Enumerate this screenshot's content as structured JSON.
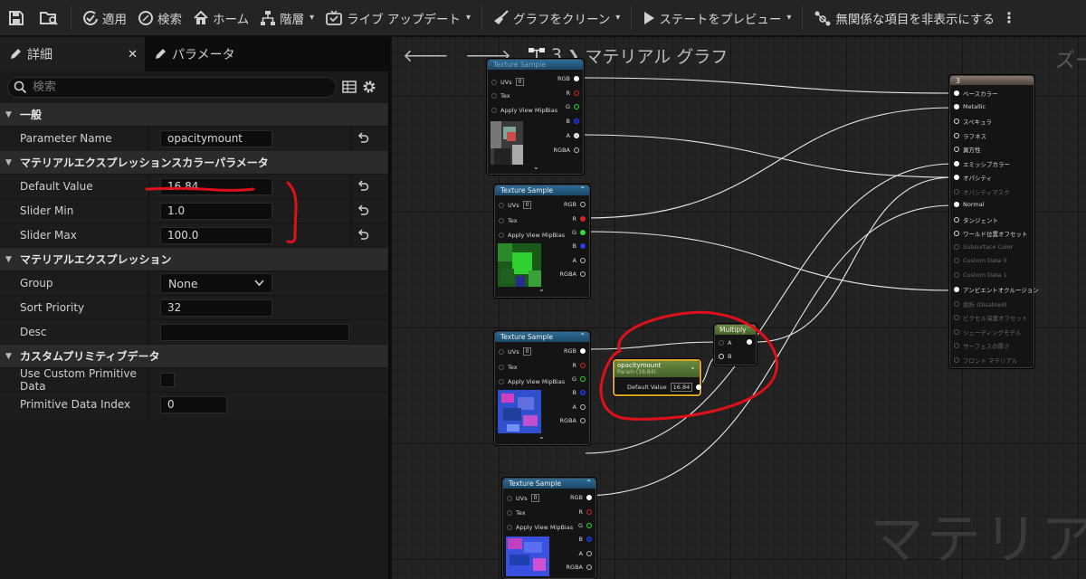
{
  "toolbar": {
    "apply": "適用",
    "search": "検索",
    "home": "ホーム",
    "hierarchy": "階層",
    "live_update": "ライブ アップデート",
    "clean_graph": "グラフをクリーン",
    "preview_state": "ステートをプレビュー",
    "hide_unrelated": "無関係な項目を非表示にする"
  },
  "details": {
    "tab_details": "詳細",
    "tab_params": "パラメータ",
    "search_placeholder": "検索",
    "cat_general": "一般",
    "cat_scalar": "マテリアルエクスプレッションスカラーパラメータ",
    "cat_expression": "マテリアルエクスプレッション",
    "cat_custom": "カスタムプリミティブデータ",
    "props": {
      "param_name_label": "Parameter Name",
      "param_name_value": "opacitymount",
      "default_value_label": "Default Value",
      "default_value_value": "16.84",
      "slider_min_label": "Slider Min",
      "slider_min_value": "1.0",
      "slider_max_label": "Slider Max",
      "slider_max_value": "100.0",
      "group_label": "Group",
      "group_value": "None",
      "sort_priority_label": "Sort Priority",
      "sort_priority_value": "32",
      "desc_label": "Desc",
      "desc_value": "",
      "use_custom_label": "Use Custom Primitive Data",
      "prim_index_label": "Primitive Data Index",
      "prim_index_value": "0"
    }
  },
  "graph": {
    "breadcrumb_num": "3",
    "breadcrumb_title": "マテリアル グラフ",
    "zoom_label": "ズー",
    "watermark": "マテリアル",
    "texture_title": "Texture Sample",
    "pin_uvs": "UVs",
    "pin_uvs_value": "0",
    "pin_tex": "Tex",
    "pin_mip": "Apply View MipBias",
    "out_rgb": "RGB",
    "out_r": "R",
    "out_g": "G",
    "out_b": "B",
    "out_a": "A",
    "out_rgba": "RGBA",
    "multiply_title": "Multiply",
    "multiply_a": "A",
    "multiply_b": "B",
    "param_title": "opacitymount",
    "param_sub": "Param (16.84)",
    "param_default_label": "Default Value",
    "param_default_value": "16.84",
    "material_title": "3",
    "material_pins": [
      {
        "label": "ベースカラー",
        "enabled": true
      },
      {
        "label": "Metallic",
        "enabled": true
      },
      {
        "label": "スペキュラ",
        "enabled": true
      },
      {
        "label": "ラフネス",
        "enabled": true
      },
      {
        "label": "異方性",
        "enabled": true
      },
      {
        "label": "エミッシブカラー",
        "enabled": true
      },
      {
        "label": "オパシティ",
        "enabled": true
      },
      {
        "label": "オパシティマスク",
        "enabled": false
      },
      {
        "label": "Normal",
        "enabled": true
      },
      {
        "label": "タンジェント",
        "enabled": true
      },
      {
        "label": "ワールド位置オフセット",
        "enabled": true
      },
      {
        "label": "Subsurface Color",
        "enabled": false
      },
      {
        "label": "Custom Data 0",
        "enabled": false
      },
      {
        "label": "Custom Data 1",
        "enabled": false
      },
      {
        "label": "アンビエントオクルージョン",
        "enabled": true
      },
      {
        "label": "屈折 (Disabled)",
        "enabled": false
      },
      {
        "label": "ピクセル深度オフセット",
        "enabled": false
      },
      {
        "label": "シェーディングモデル",
        "enabled": false
      },
      {
        "label": "サーフェスの厚さ",
        "enabled": false
      },
      {
        "label": "フロント マテリアル",
        "enabled": false
      }
    ]
  },
  "colors": {
    "annotation_red": "#e0101a",
    "param_border": "#d9a41e",
    "texture_header": "#2d6c98",
    "multiply_header": "#6a8a40"
  }
}
